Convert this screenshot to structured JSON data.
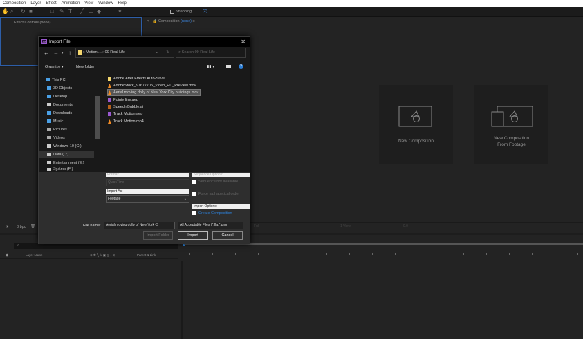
{
  "menu": [
    "Composition",
    "Layer",
    "Effect",
    "Animation",
    "View",
    "Window",
    "Help"
  ],
  "toolbar": {
    "snapping": "Snapping"
  },
  "effect_controls": {
    "title": "Effect Controls (none)"
  },
  "composition": {
    "title": "Composition",
    "value": "(none)"
  },
  "cards": [
    {
      "label": "New Composition"
    },
    {
      "label": "New Composition",
      "label2": "From Footage"
    }
  ],
  "project": {
    "bpc": "8 bpc"
  },
  "viewer": {
    "zoom": "Full",
    "views": "1 View",
    "exposure": "+0.0"
  },
  "timeline": {
    "col_layer": "Layer Name",
    "col_parent": "Parent & Link"
  },
  "dialog": {
    "title": "Import File",
    "app_badge": "Ae",
    "breadcrumb": [
      "« Motion ...",
      "09 Real Life"
    ],
    "search_placeholder": "Search 09 Real Life",
    "organize": "Organize ▾",
    "new_folder": "New folder",
    "nav": [
      "This PC",
      "3D Objects",
      "Desktop",
      "Documents",
      "Downloads",
      "Music",
      "Pictures",
      "Videos",
      "Windows 10 (C:)",
      "Data (D:)",
      "Entertainment (E:)",
      "System (F:)"
    ],
    "files": [
      {
        "name": "Adobe After Effects Auto-Save",
        "type": "folder",
        "color": "#f5d76e"
      },
      {
        "name": "AdobeStock_97677705_Video_HD_Preview.mov",
        "type": "vlc",
        "color": "#f08a24"
      },
      {
        "name": "Aerial moving dolly of New York City buildings.mov",
        "type": "vlc",
        "color": "#f08a24",
        "selected": true
      },
      {
        "name": "Pointy line.aep",
        "type": "aep",
        "color": "#9b59d0"
      },
      {
        "name": "Speech Bubble.ai",
        "type": "ai",
        "color": "#b8621b"
      },
      {
        "name": "Track Motion.aep",
        "type": "aep",
        "color": "#9b59d0"
      },
      {
        "name": "Track Motion.mp4",
        "type": "vlc",
        "color": "#f08a24"
      }
    ],
    "format_label": "Format:",
    "format_value": "QuickTime",
    "import_as_label": "Import As:",
    "import_as_value": "Footage",
    "sequence_label": "Sequence Options:",
    "sequence_not_available": "Sequence not available",
    "force_alpha": "Force alphabetical order",
    "import_options_label": "Import Options:",
    "create_composition": "Create Composition",
    "file_name_label": "File name:",
    "file_name_value": "Aerial moving dolly of New York C",
    "file_type": "All Acceptable Files (*.fla;*.prpr",
    "import_folder": "Import Folder",
    "import": "Import",
    "cancel": "Cancel"
  }
}
